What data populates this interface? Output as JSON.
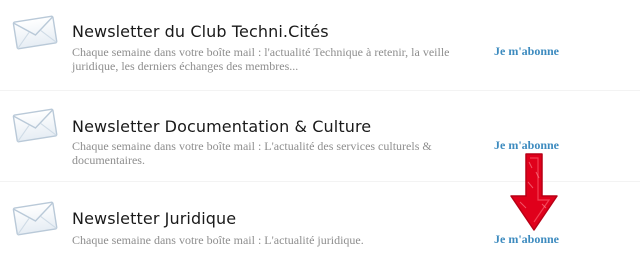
{
  "newsletters": [
    {
      "title": "Newsletter du Club Techni.Cités",
      "description": "Chaque semaine dans votre boîte mail : l'actualité Technique à retenir, la veille juridique, les derniers échanges des membres...",
      "action_label": "Je m'abonne",
      "icon": "envelope-icon"
    },
    {
      "title": "Newsletter Documentation & Culture",
      "description": "Chaque semaine dans votre boîte mail : L'actualité des services culturels & documentaires.",
      "action_label": "Je m'abonne",
      "icon": "envelope-icon"
    },
    {
      "title": "Newsletter Juridique",
      "description": "Chaque semaine dans votre boîte mail : L'actualité juridique.",
      "action_label": "Je m'abonne",
      "icon": "envelope-icon"
    }
  ],
  "colors": {
    "title": "#1a1a1a",
    "description": "#8e8e8e",
    "link": "#3d8bbf",
    "arrow": "#e0001b",
    "envelope_stroke": "#b9c9d8",
    "envelope_fill": "#f2f6fa"
  },
  "annotation": {
    "icon": "red-down-arrow-icon",
    "points_to": "newsletters.2.action_label"
  }
}
